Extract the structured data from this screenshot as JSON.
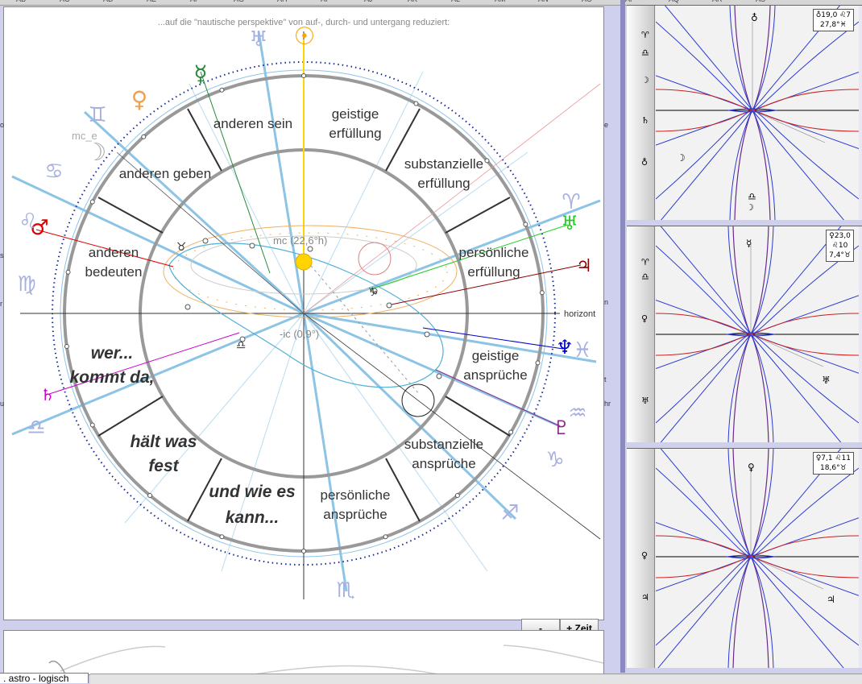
{
  "column_headers": [
    "AB",
    "AC",
    "AD",
    "AE",
    "AF",
    "AG",
    "AH",
    "AI",
    "AJ",
    "AK",
    "AL",
    "AM",
    "AN",
    "AO",
    "AP",
    "AQ",
    "AR",
    "AS"
  ],
  "chart": {
    "top_caption": "...auf die \"nautische perspektive\" von auf-, durch- und untergang reduziert:",
    "houses": {
      "anderen_sein": "anderen sein",
      "geistige_erfuellung": [
        "geistige",
        "erfüllung"
      ],
      "anderen_geben": "anderen geben",
      "substanzielle_erfuellung": [
        "substanzielle",
        "erfüllung"
      ],
      "anderen_bedeuten": [
        "anderen",
        "bedeuten"
      ],
      "persoenliche_erfuellung": [
        "persönliche",
        "erfüllung"
      ],
      "geistige_ansprueche": [
        "geistige",
        "ansprüche"
      ],
      "substanzielle_ansprueche": [
        "substanzielle",
        "ansprüche"
      ],
      "persoenliche_ansprueche": [
        "persönliche",
        "ansprüche"
      ]
    },
    "bold_italic": {
      "wer": "wer...",
      "kommt": "kommt da,",
      "haelt1": "hält was",
      "haelt2": "fest",
      "und1": "und wie es",
      "und2": "kann..."
    },
    "labels": {
      "mc": "mc (22,6°h)",
      "ic": "-ic (0,9°)",
      "mc_e": "mc_e",
      "horizont": "horizont"
    },
    "planet_glyphs": {
      "sun": "☉",
      "mercury": "☿",
      "venus": "♀",
      "mars": "♂",
      "jupiter": "♃",
      "saturn": "♄",
      "uranus": "♅",
      "neptune": "♆",
      "pluto": "♇",
      "moon": "☽",
      "uranus_top": "♅"
    },
    "sign_glyphs": {
      "gemini": "♊",
      "cancer": "♋",
      "leo": "♌",
      "virgo": "♍",
      "libra": "♎",
      "scorpio": "♏",
      "sagittarius": "♐",
      "capricorn": "♑",
      "aquarius": "♒",
      "pisces": "♓",
      "aries": "♈",
      "taurus": "♉"
    },
    "left_edge_letters": [
      "o",
      "s",
      "r",
      "u"
    ],
    "right_edge_letters": [
      "e",
      "n",
      "t",
      "hr"
    ]
  },
  "buttons": {
    "minus": "-",
    "plus_zeit": "+ Zeit"
  },
  "sheet_tab": ". astro - logisch",
  "panels": [
    {
      "info": [
        "♁19,0 ♌7",
        "27,8°♓"
      ],
      "left_glyphs": [
        "♈",
        "♎",
        "☽",
        "♄",
        "♁"
      ],
      "plot_glyphs": {
        "top": "♁",
        "mid": "☽",
        "bottom": "♎",
        "bottom2": "☽"
      }
    },
    {
      "info": [
        "♀23,0",
        "♌10",
        "7,4°♉"
      ],
      "left_glyphs": [
        "♈",
        "♎",
        "♀",
        "♅"
      ],
      "plot_glyphs": {
        "top": "☿",
        "bottom": "♅"
      }
    },
    {
      "info": [
        "♀7,1 ♌11",
        "18,6°♉"
      ],
      "left_glyphs": [
        "♀",
        "♃"
      ],
      "plot_glyphs": {
        "top": "♀",
        "bottom": "♃"
      }
    }
  ],
  "colors": {
    "sky_line": "#8cc4e6",
    "chart_gray": "#8a8a8a",
    "sun": "#ffd400",
    "mars": "#e00000",
    "mercury": "#2a8a3a",
    "venus": "#f0a050",
    "uranus": "#22cc22",
    "jupiter": "#8b0000",
    "neptune": "#0000cc",
    "pluto": "#8b2c8b",
    "saturn": "#cc00cc",
    "sign_glyph": "#a8b0e0"
  }
}
